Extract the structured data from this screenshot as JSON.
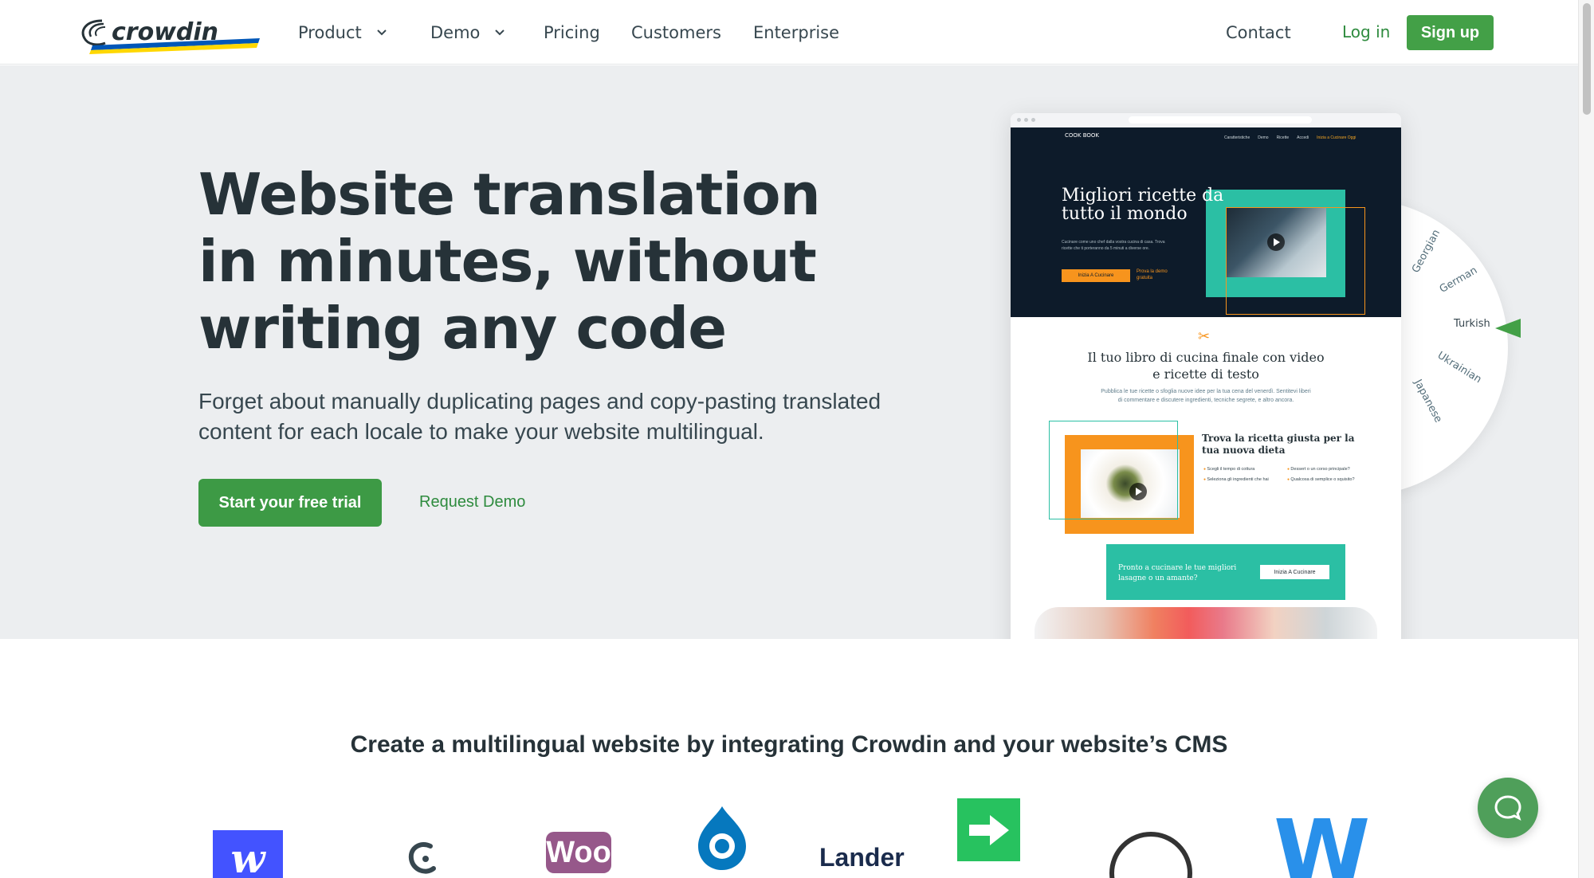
{
  "brand": {
    "name": "crowdin",
    "accent": "#43a047",
    "ukraine_blue": "#0057b8",
    "ukraine_yellow": "#ffd700"
  },
  "nav": {
    "items": [
      {
        "label": "Product",
        "has_dropdown": true
      },
      {
        "label": "Demo",
        "has_dropdown": true
      },
      {
        "label": "Pricing"
      },
      {
        "label": "Customers"
      },
      {
        "label": "Enterprise"
      }
    ],
    "contact": "Contact",
    "login": "Log in",
    "signup": "Sign up"
  },
  "hero": {
    "title": "Website translation in minutes, without writing any code",
    "subtitle": "Forget about manually duplicating pages and copy-pasting translated content for each locale to make your website multilingual.",
    "primary_cta": "Start your free trial",
    "secondary_cta": "Request Demo"
  },
  "mockup": {
    "logo": "COOK BOOK",
    "menu": [
      "Caratteristiche",
      "Demo",
      "Ricette",
      "Accedi",
      "Inizia a Cucinare Oggi"
    ],
    "headline": "Migliori ricette da tutto il mondo",
    "intro": "Cucinare come uno chef dalla vostra cucina di casa. Trova ricette che ti porteranno da 5 minuti a diverse ore.",
    "btn_primary": "Inizia A Cucinare",
    "btn_secondary": "Prova la demo gratuita",
    "section_title": "Il tuo libro di cucina finale con video e ricette di testo",
    "section_text": "Pubblica le tue ricette o sfoglia nuove idee per la tua cena del venerdì. Sentitevi liberi di commentare e discutere ingredienti, tecniche segrete, e altro ancora.",
    "feature_title": "Trova la ricetta giusta per la tua nuova dieta",
    "bullets": [
      "Scegli il tempo di cottura",
      "Dessert o un corso principale?",
      "Seleziona gli ingredienti che hai",
      "Qualcosa di semplice o squisito?"
    ],
    "band_text": "Pronto a cucinare le tue migliori lasagne o un amante?",
    "band_btn": "Inizia A Cucinare",
    "teal": "#2bbfa4",
    "orange": "#f7941d"
  },
  "languages": [
    "Georgian",
    "German",
    "Turkish",
    "Ukrainian",
    "Japanese"
  ],
  "integrations": {
    "title": "Create a multilingual website by integrating Crowdin and your website’s CMS",
    "logos": [
      "webflow-logo",
      "contentful-logo",
      "woocommerce-logo",
      "drupal-logo",
      "lander-logo",
      "arrow-logo",
      "circle-logo",
      "weebly-logo"
    ],
    "woo_text": "Woo",
    "lander_text": "Lander",
    "webflow_text": "w",
    "weebly_text": "W"
  }
}
